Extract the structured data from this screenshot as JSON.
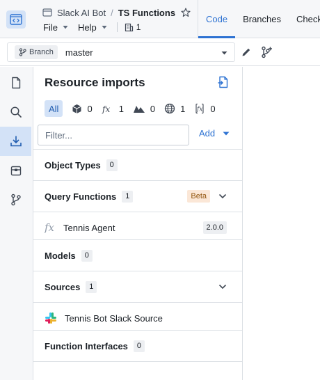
{
  "header": {
    "project": "Slack AI Bot",
    "repo_title": "TS Functions",
    "menu": [
      {
        "label": "File"
      },
      {
        "label": "Help"
      }
    ],
    "resource_count": "1",
    "tabs": [
      {
        "label": "Code",
        "active": true
      },
      {
        "label": "Branches",
        "active": false
      },
      {
        "label": "Checks",
        "active": false
      }
    ]
  },
  "branchbar": {
    "tag_label": "Branch",
    "branch_name": "master"
  },
  "rail": {
    "items": [
      {
        "icon": "document-icon",
        "active": false
      },
      {
        "icon": "search-icon",
        "active": false
      },
      {
        "icon": "import-icon",
        "active": true
      },
      {
        "icon": "package-icon",
        "active": false
      },
      {
        "icon": "git-branch-icon",
        "active": false
      }
    ]
  },
  "panel": {
    "title": "Resource imports",
    "filters": {
      "all_label": "All",
      "object_count": "0",
      "function_count": "1",
      "model_count": "0",
      "source_count": "1",
      "interface_count": "0"
    },
    "filter_placeholder": "Filter...",
    "add_label": "Add",
    "groups": [
      {
        "label": "Object Types",
        "count": "0"
      },
      {
        "label": "Query Functions",
        "count": "1",
        "badge": "Beta"
      },
      {
        "item": "Tennis Agent",
        "version": "2.0.0"
      },
      {
        "label": "Models",
        "count": "0"
      },
      {
        "label": "Sources",
        "count": "1"
      },
      {
        "item": "Tennis Bot Slack Source"
      },
      {
        "label": "Function Interfaces",
        "count": "0"
      }
    ]
  },
  "colors": {
    "accent": "#2d72d2",
    "active_bg": "#d3e2f7",
    "beta_bg": "#fbe7d7",
    "beta_text": "#935610"
  }
}
